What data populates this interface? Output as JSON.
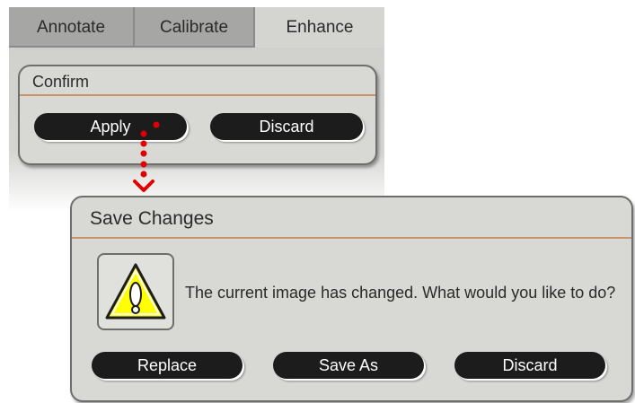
{
  "tabs": [
    {
      "label": "Annotate"
    },
    {
      "label": "Calibrate"
    },
    {
      "label": "Enhance"
    }
  ],
  "confirm_panel": {
    "title": "Confirm",
    "apply_label": "Apply",
    "discard_label": "Discard"
  },
  "save_dialog": {
    "title": "Save Changes",
    "message": "The current image has changed. What would you like to do?",
    "icon": "warning-icon",
    "replace_label": "Replace",
    "save_as_label": "Save As",
    "discard_label": "Discard"
  },
  "colors": {
    "panel_bg": "#d8d8d4",
    "button_bg": "#1c1c1c",
    "title_rule": "#c9946c",
    "flow_arrow": "#e00000",
    "warning_fill": "#ffff00"
  }
}
